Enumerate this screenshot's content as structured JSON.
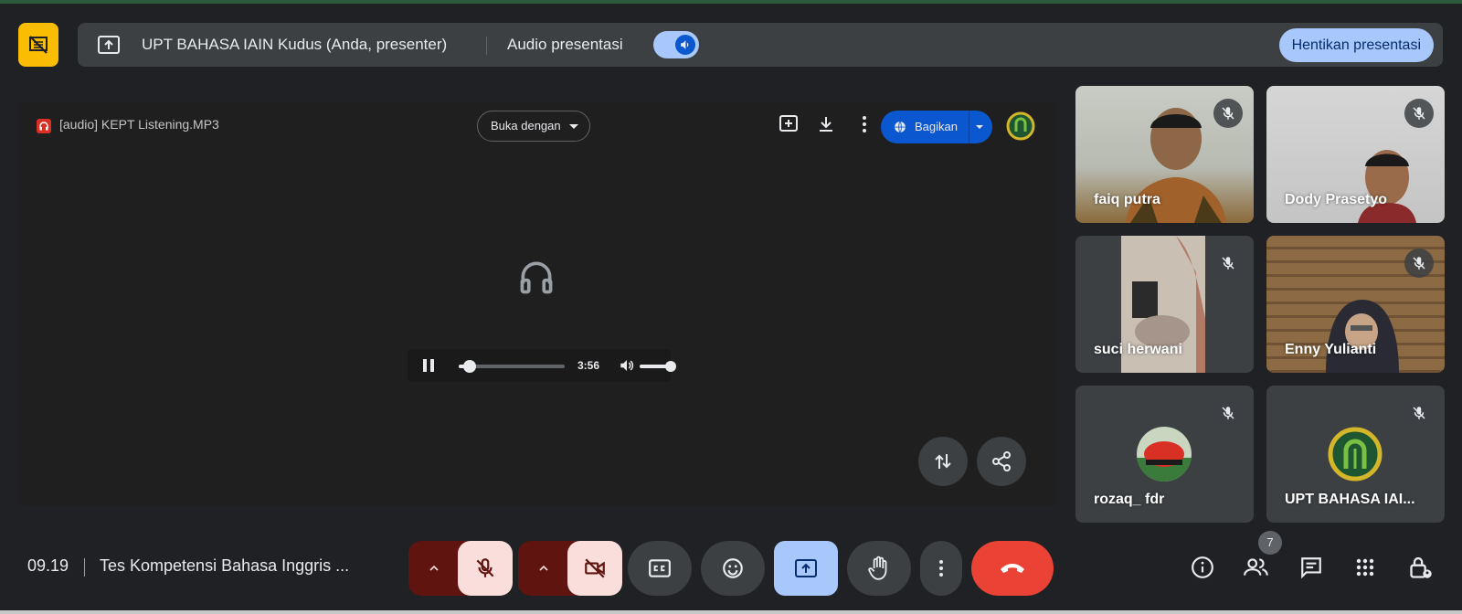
{
  "presenter_bar": {
    "presenting_text": "UPT BAHASA IAIN Kudus (Anda, presenter)",
    "audio_label": "Audio presentasi",
    "stop_button": "Hentikan presentasi"
  },
  "stage": {
    "file_name": "[audio] KEPT Listening.MP3",
    "open_with_label": "Buka dengan",
    "share_label": "Bagikan",
    "player": {
      "duration": "3:56",
      "progress_fraction": 0.1,
      "volume_fraction": 1.0
    }
  },
  "participants": [
    {
      "name": "faiq putra",
      "muted": true
    },
    {
      "name": "Dody Prasetyo",
      "muted": true
    },
    {
      "name": "suci herwani",
      "muted": true
    },
    {
      "name": "Enny Yulianti",
      "muted": true
    },
    {
      "name": "rozaq_ fdr",
      "muted": true
    },
    {
      "name": "UPT BAHASA IAI...",
      "muted": true
    }
  ],
  "bottom_bar": {
    "time": "09.19",
    "meeting_title": "Tes Kompetensi Bahasa Inggris ...",
    "people_count": "7"
  },
  "colors": {
    "background": "#202124",
    "presenter_warning": "#fbbc04",
    "accent_blue": "#a8c7fa",
    "end_call_red": "#ea4335",
    "muted_bg": "#f9dedc"
  }
}
